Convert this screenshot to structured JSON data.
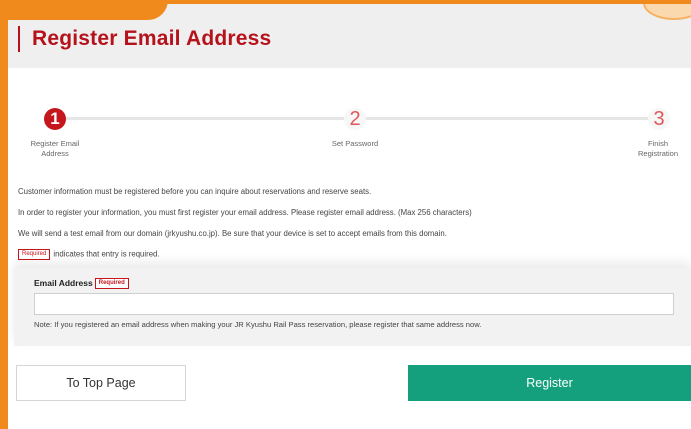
{
  "page": {
    "title": "Register Email Address"
  },
  "stepper": {
    "steps": [
      {
        "number": "1",
        "label": "Register Email\nAddress",
        "state": "active"
      },
      {
        "number": "2",
        "label": "Set Password",
        "state": "inactive"
      },
      {
        "number": "3",
        "label": "Finish\nRegistration",
        "state": "inactive"
      }
    ]
  },
  "info": {
    "line1": "Customer information must be registered before you can inquire about reservations and reserve seats.",
    "line2": "In order to register your information, you must first register your email address. Please register email address. (Max 256 characters)",
    "line3": "We will send a test email from our domain (jrkyushu.co.jp). Be sure that your device is set to accept emails from this domain.",
    "required_badge": "Required",
    "required_note": "indicates that entry is required."
  },
  "form": {
    "email_label": "Email Address",
    "required_badge": "Required",
    "email_value": "",
    "note": "Note: If you registered an email address when making your JR Kyushu Rail Pass reservation, please register that same address now."
  },
  "buttons": {
    "top_page": "To Top Page",
    "register": "Register"
  },
  "colors": {
    "accent_red": "#c4161c",
    "register_green": "#14a07c",
    "frame_orange": "#f08a1c"
  }
}
